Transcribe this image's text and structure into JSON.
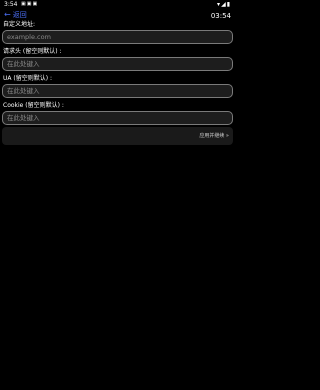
{
  "status_bar": {
    "time": "3:54",
    "left_icons": [
      "notification-icon",
      "notification-icon",
      "notification-icon"
    ],
    "right_icons": [
      "wifi-icon",
      "signal-icon",
      "battery-icon"
    ]
  },
  "header": {
    "back_label": "返回",
    "clock": "03:54"
  },
  "form": {
    "url_label": "自定义地址:",
    "url_placeholder": "example.com",
    "headers_label": "请求头 (留空则默认) :",
    "headers_placeholder": "在此处键入",
    "ua_label": "UA (留空则默认) :",
    "ua_placeholder": "在此处键入",
    "cookie_label": "Cookie (留空则默认) :",
    "cookie_placeholder": "在此处键入"
  },
  "actions": {
    "more_label": "应用并继续 »"
  },
  "colors": {
    "accent": "#4a6ef5",
    "background": "#000000",
    "field_bg": "#1d1d1d",
    "field_border": "#7a7a7a"
  }
}
